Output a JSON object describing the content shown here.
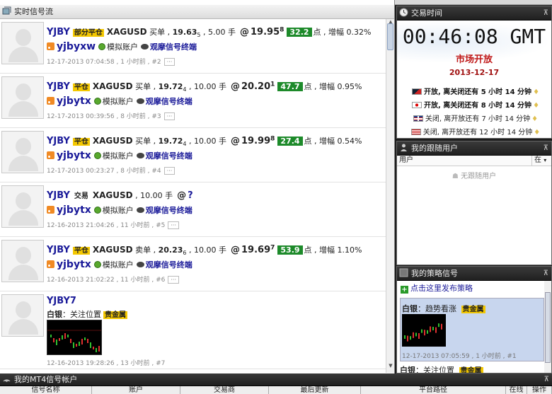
{
  "feed_header": {
    "title": "实时信号流"
  },
  "feed": [
    {
      "symbol": "YJBY",
      "tag": "部分平仓",
      "pair": "XAGUSD",
      "side": "买单",
      "open_price": "19.63",
      "open_sub": "5",
      "lots": "5.00 手",
      "close_price": "19.95",
      "close_sup": "8",
      "points": "32.2",
      "points_unit": "点",
      "gain_label": "增幅",
      "gain": "0.32%",
      "user": "yjbyxw",
      "account": "模拟账户",
      "terminal": "观摩信号终端",
      "time": "12-17-2013 07:04:58",
      "ago": "1 小时前",
      "num": "#2"
    },
    {
      "symbol": "YJBY",
      "tag": "平仓",
      "pair": "XAGUSD",
      "side": "买单",
      "open_price": "19.72",
      "open_sub": "4",
      "lots": "10.00 手",
      "close_price": "20.20",
      "close_sup": "1",
      "points": "47.7",
      "points_unit": "点",
      "gain_label": "增幅",
      "gain": "0.95%",
      "user": "yjbytx",
      "account": "模拟账户",
      "terminal": "观摩信号终端",
      "time": "12-17-2013 00:39:56",
      "ago": "8 小时前",
      "num": "#3"
    },
    {
      "symbol": "YJBY",
      "tag": "平仓",
      "pair": "XAGUSD",
      "side": "买单",
      "open_price": "19.72",
      "open_sub": "4",
      "lots": "10.00 手",
      "close_price": "19.99",
      "close_sup": "8",
      "points": "27.4",
      "points_unit": "点",
      "gain_label": "增幅",
      "gain": "0.54%",
      "user": "yjbytx",
      "account": "模拟账户",
      "terminal": "观摩信号终端",
      "time": "12-17-2013 00:23:27",
      "ago": "8 小时前",
      "num": "#4"
    },
    {
      "symbol": "YJBY",
      "tag": "交易",
      "pair": "XAGUSD",
      "lots": "10.00 手",
      "at_price": "?",
      "user": "yjbytx",
      "account": "模拟账户",
      "terminal": "观摩信号终端",
      "time": "12-16-2013 21:04:26",
      "ago": "11 小时前",
      "num": "#5"
    },
    {
      "symbol": "YJBY",
      "tag": "平仓",
      "pair": "XAGUSD",
      "side": "卖单",
      "open_price": "20.23",
      "open_sub": "6",
      "lots": "10.00 手",
      "close_price": "19.69",
      "close_sup": "7",
      "points": "53.9",
      "points_unit": "点",
      "gain_label": "增幅",
      "gain": "1.10%",
      "user": "yjbytx",
      "account": "模拟账户",
      "terminal": "观摩信号终端",
      "time": "12-16-2013 21:02:22",
      "ago": "11 小时前",
      "num": "#6"
    },
    {
      "symbol": "YJBY7",
      "label": "白银",
      "focus": "关注位置",
      "tag": "贵金属",
      "time": "12-16-2013 19:28:26",
      "ago": "13 小时前",
      "num": "#7"
    }
  ],
  "clock_panel": {
    "title": "交易时间",
    "time": "00:46:08 GMT",
    "status": "市场开放",
    "date": "2013-12-17",
    "markets": [
      {
        "flag": "au",
        "text_a": "开放, 离关闭还有",
        "hours": "5 小时",
        "mins": "14 分钟",
        "bold": true
      },
      {
        "flag": "jp",
        "text_a": "开放, 离关闭还有",
        "hours": "8 小时",
        "mins": "14 分钟",
        "bold": true
      },
      {
        "flag": "uk",
        "text_a": "关闭, 离开放还有",
        "hours": "7 小时",
        "mins": "14 分钟",
        "bold": false
      },
      {
        "flag": "us",
        "text_a": "关闭, 离开放还有",
        "hours": "12 小时",
        "mins": "14 分钟",
        "bold": false
      }
    ]
  },
  "follow_panel": {
    "title": "我的跟随用户",
    "col_user": "用户",
    "col_status": "在",
    "empty": "无跟随用户"
  },
  "strategy_panel": {
    "title": "我的策略信号",
    "publish": "点击这里发布策略",
    "item": {
      "label": "白银",
      "text": "趋势看涨",
      "tag": "贵金属",
      "time": "12-17-2013 07:05:59",
      "ago": "1 小时前",
      "num": "#1"
    },
    "item2": {
      "label": "白银",
      "text": "关注位置",
      "tag": "贵金属"
    }
  },
  "bottom_panel": {
    "title": "我的MT4信号帐户",
    "columns": [
      "信号名称",
      "账户",
      "交易商",
      "最后更新",
      "平台路径",
      "在线",
      "操作"
    ]
  },
  "colors": {
    "accent_blue": "#1a1a99",
    "tag_yellow": "#f4c800",
    "points_green": "#1d8a2a",
    "market_red": "#c01818"
  }
}
